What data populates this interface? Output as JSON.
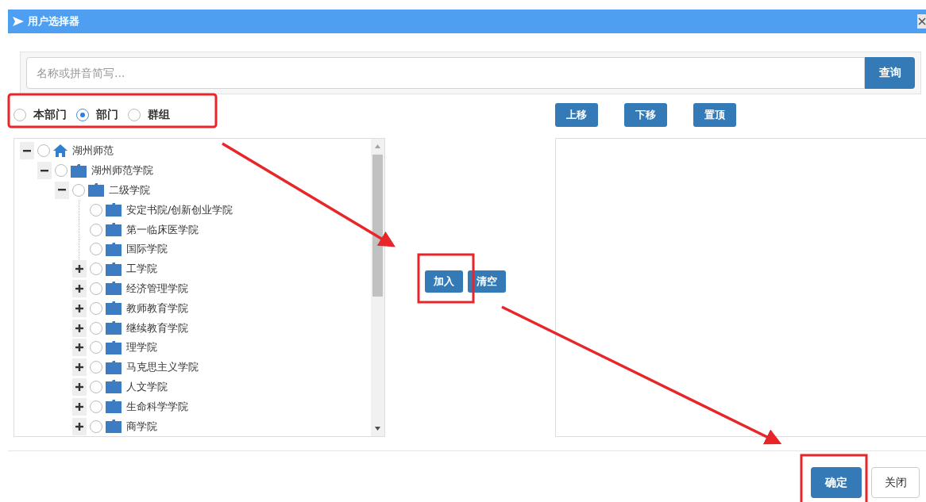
{
  "window": {
    "title": "用户选择器"
  },
  "search": {
    "placeholder": "名称或拼音简写...",
    "button": "查询"
  },
  "scope_options": [
    {
      "label": "本部门",
      "selected": false
    },
    {
      "label": "部门",
      "selected": true
    },
    {
      "label": "群组",
      "selected": false
    }
  ],
  "tree": [
    {
      "label": "湖州师范",
      "kind": "home",
      "expanded": true,
      "selected": false,
      "children": [
        {
          "label": "湖州师范学院",
          "kind": "folder",
          "expanded": true,
          "selected": false,
          "children": [
            {
              "label": "二级学院",
              "kind": "folder",
              "expanded": true,
              "selected": false,
              "children": [
                {
                  "label": "安定书院/创新创业学院",
                  "kind": "leaf",
                  "selected": false
                },
                {
                  "label": "第一临床医学院",
                  "kind": "leaf",
                  "selected": false
                },
                {
                  "label": "国际学院",
                  "kind": "leaf",
                  "selected": false
                },
                {
                  "label": "工学院",
                  "kind": "folder",
                  "expanded": false,
                  "selected": false
                },
                {
                  "label": "经济管理学院",
                  "kind": "folder",
                  "expanded": false,
                  "selected": false
                },
                {
                  "label": "教师教育学院",
                  "kind": "folder",
                  "expanded": false,
                  "selected": false
                },
                {
                  "label": "继续教育学院",
                  "kind": "folder",
                  "expanded": false,
                  "selected": false
                },
                {
                  "label": "理学院",
                  "kind": "folder",
                  "expanded": false,
                  "selected": false
                },
                {
                  "label": "马克思主义学院",
                  "kind": "folder",
                  "expanded": false,
                  "selected": false
                },
                {
                  "label": "人文学院",
                  "kind": "folder",
                  "expanded": false,
                  "selected": false
                },
                {
                  "label": "生命科学学院",
                  "kind": "folder",
                  "expanded": false,
                  "selected": false
                },
                {
                  "label": "商学院",
                  "kind": "folder",
                  "expanded": false,
                  "selected": false
                }
              ]
            }
          ]
        }
      ]
    }
  ],
  "transfer_buttons": [
    "加入",
    "清空"
  ],
  "order_buttons": [
    "上移",
    "下移",
    "置顶"
  ],
  "footer_buttons": [
    {
      "label": "确定",
      "kind": "primary"
    },
    {
      "label": "关闭",
      "kind": "default"
    }
  ]
}
